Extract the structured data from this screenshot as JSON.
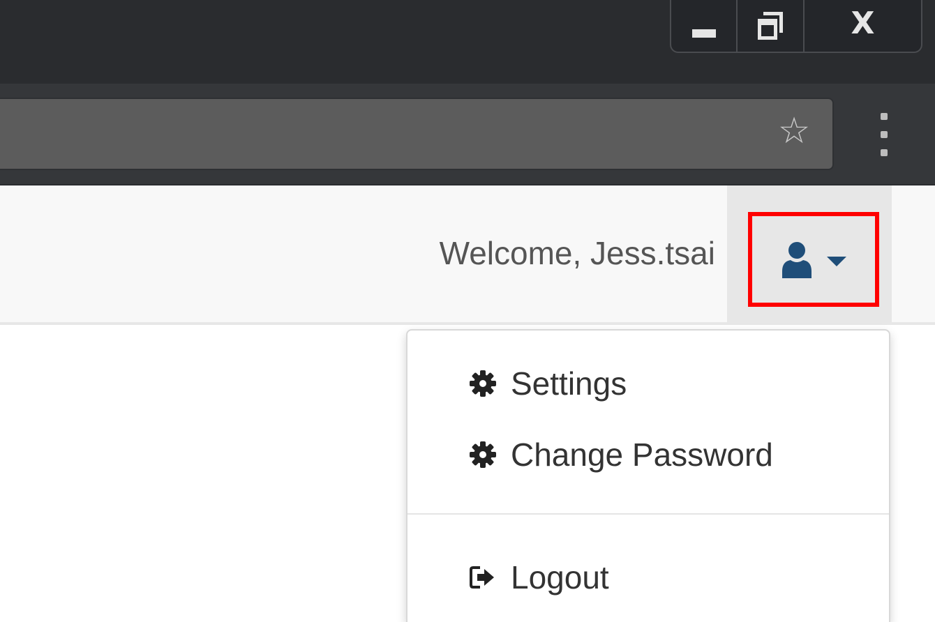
{
  "window": {
    "controls": {
      "close_label": "X"
    }
  },
  "browser": {
    "star_glyph": "☆"
  },
  "navbar": {
    "welcome_text": "Welcome, Jess.tsai",
    "accent_color": "#1f4e79",
    "highlight_color": "#ff0000"
  },
  "dropdown": {
    "items": [
      {
        "label": "Settings",
        "icon": "gear-icon"
      },
      {
        "label": "Change Password",
        "icon": "gear-icon"
      },
      {
        "label": "Logout",
        "icon": "sign-out-icon"
      }
    ]
  }
}
